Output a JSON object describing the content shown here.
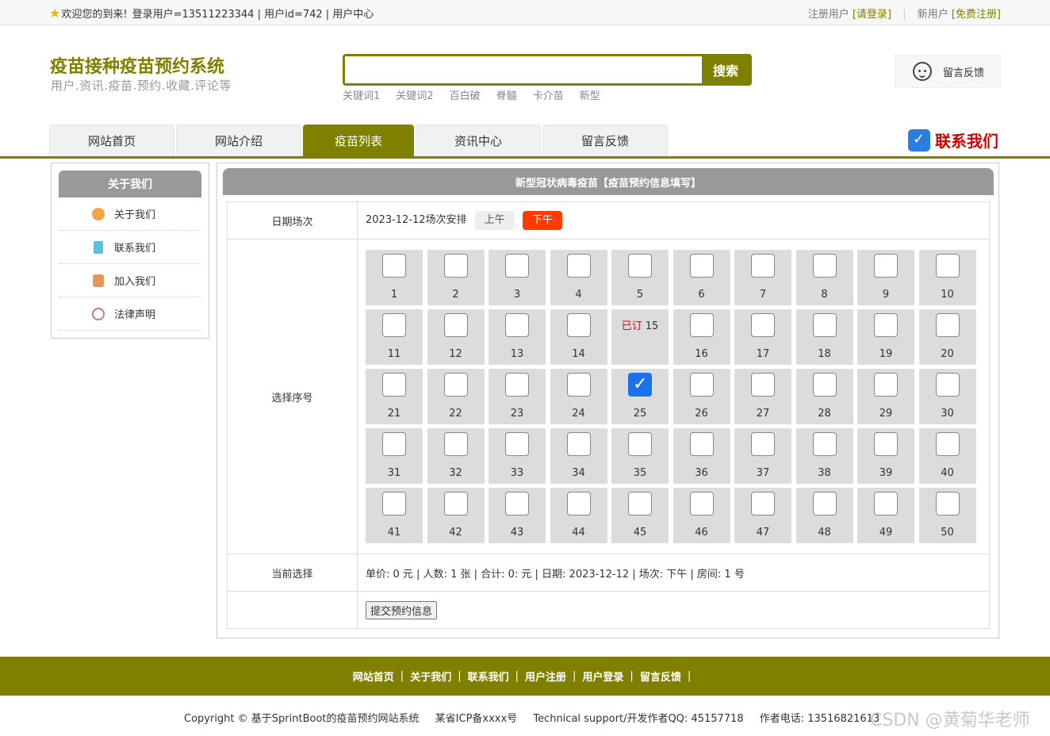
{
  "topbar": {
    "welcome": "欢迎您的到来!",
    "user_info": "登录用户=13511223344 | 用户id=742 | 用户中心",
    "register_prefix": "注册用户",
    "login_link": "[请登录]",
    "new_user_prefix": "新用户",
    "signup_link": "[免费注册]"
  },
  "header": {
    "title": "疫苗接种疫苗预约系统",
    "subtitle": "用户.资讯.疫苗.预约.收藏.评论等",
    "search_placeholder": "",
    "search_button": "搜索",
    "keywords": [
      "关键词1",
      "关键词2",
      "百白破",
      "脊髓",
      "卡介苗",
      "新型"
    ],
    "feedback": "留言反馈"
  },
  "nav": {
    "items": [
      "网站首页",
      "网站介绍",
      "疫苗列表",
      "资讯中心",
      "留言反馈"
    ],
    "active_index": 2,
    "contact_us": "联系我们"
  },
  "sidebar": {
    "title": "关于我们",
    "items": [
      {
        "label": "关于我们",
        "icon": "about-icon",
        "color": "#f4a340"
      },
      {
        "label": "联系我们",
        "icon": "clipboard-icon",
        "color": "#5bc0de"
      },
      {
        "label": "加入我们",
        "icon": "lock-icon",
        "color": "#e8955a"
      },
      {
        "label": "法律声明",
        "icon": "power-icon",
        "color": "#c47b7b"
      }
    ]
  },
  "main": {
    "title": "新型冠状病毒疫苗【疫苗预约信息填写】",
    "date_label": "日期场次",
    "date_text": "2023-12-12场次安排",
    "am_label": "上午",
    "pm_label": "下午",
    "seat_label": "选择序号",
    "booked_tag": "已订",
    "booked_seats": [
      15
    ],
    "selected_seats": [
      25
    ],
    "seat_count": 50,
    "current_label": "当前选择",
    "current_text": "单价: 0 元 | 人数: 1 张 | 合计: 0: 元 | 日期: 2023-12-12 | 场次: 下午 | 房间: 1 号",
    "submit_label": "提交预约信息"
  },
  "footer": {
    "links": [
      "网站首页",
      "关于我们",
      "联系我们",
      "用户注册",
      "用户登录",
      "留言反馈"
    ],
    "copyright": "Copyright © 基于SprintBoot的疫苗预约网站系统",
    "icp": "某省ICP备xxxx号",
    "support": "Technical support/开发作者QQ: 45157718",
    "phone": "作者电话: 13516821613",
    "watermark": "CSDN @黄菊华老师"
  },
  "colors": {
    "brand": "#808000",
    "panel_header": "#999999",
    "pm_active": "#ff3b00",
    "checkbox_checked": "#1a73e8"
  }
}
